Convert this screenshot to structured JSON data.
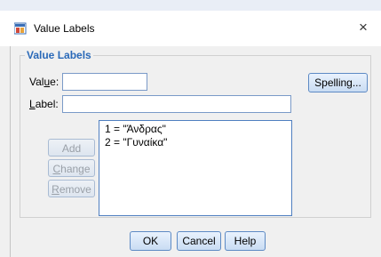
{
  "window": {
    "title": "Value Labels",
    "close_glyph": "×",
    "icon": "spss-app-icon"
  },
  "group": {
    "legend": "Value Labels"
  },
  "fields": {
    "value": {
      "label_pre": "Val",
      "label_mnemonic": "u",
      "label_post": "e:",
      "value": ""
    },
    "label": {
      "label_pre": "",
      "label_mnemonic": "L",
      "label_post": "abel:",
      "value": ""
    }
  },
  "buttons": {
    "spelling": "Spelling...",
    "add": "Add",
    "change": {
      "mnemonic": "C",
      "rest": "hange"
    },
    "remove": {
      "mnemonic": "R",
      "rest": "emove"
    },
    "ok": "OK",
    "cancel": "Cancel",
    "help": "Help"
  },
  "list": {
    "items": [
      "1 = \"Άνδρας\"",
      "2 = \"Γυναίκα\""
    ]
  },
  "colors": {
    "accent": "#2a69b8",
    "button_border": "#5d8ac4"
  }
}
